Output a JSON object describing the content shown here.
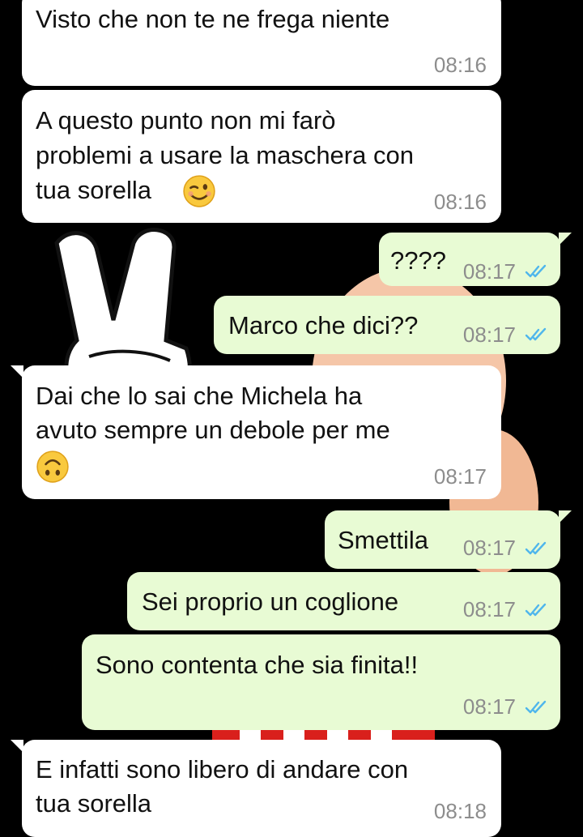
{
  "messages": [
    {
      "direction": "in",
      "text": "Visto che non te ne frega niente",
      "time": "08:16"
    },
    {
      "direction": "in",
      "line1": "A questo punto non mi farò",
      "line2": "problemi a usare la maschera con",
      "line3": "tua sorella",
      "emoji": "winking-face-emoji",
      "time": "08:16"
    },
    {
      "direction": "out",
      "text": "????",
      "time": "08:17",
      "status": "read-double-tick-icon"
    },
    {
      "direction": "out",
      "text": "Marco che dici??",
      "time": "08:17",
      "status": "read-double-tick-icon"
    },
    {
      "direction": "in",
      "line1": "Dai che lo sai che Michela ha",
      "line2": "avuto sempre un debole per me",
      "emoji": "upside-down-face-emoji",
      "time": "08:17"
    },
    {
      "direction": "out",
      "text": "Smettila",
      "time": "08:17",
      "status": "read-double-tick-icon"
    },
    {
      "direction": "out",
      "text": "Sei proprio un coglione",
      "time": "08:17",
      "status": "read-double-tick-icon"
    },
    {
      "direction": "out",
      "text": "Sono contenta che sia finita!!",
      "time": "08:17",
      "status": "read-double-tick-icon"
    },
    {
      "direction": "in",
      "line1": "E infatti sono libero di andare con",
      "line2": "tua sorella",
      "time": "08:18"
    }
  ],
  "colors": {
    "background": "#000000",
    "incoming_bubble": "#ffffff",
    "outgoing_bubble": "#e8fbd4",
    "timestamp": "#8d8d8d",
    "read_ticks": "#4fb6ec"
  }
}
